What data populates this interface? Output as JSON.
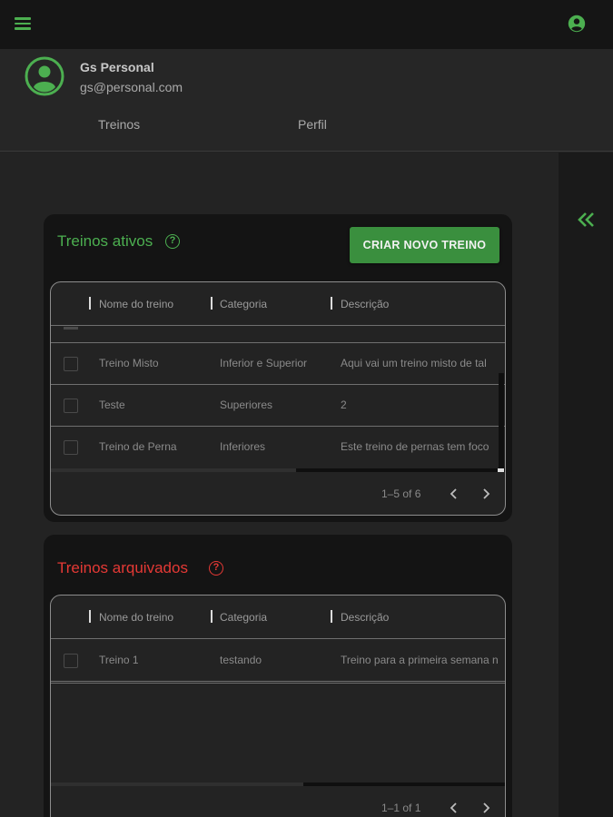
{
  "colors": {
    "accent_green": "#4caf50",
    "archived_red": "#e53935",
    "button_green": "#3a8f3e"
  },
  "icons": {
    "menu": "menu-icon",
    "account": "account-circle-icon",
    "avatar": "account-circle-icon",
    "collapse": "double-chevron-left-icon",
    "help": "help-circle-icon",
    "prev": "chevron-left-icon",
    "next": "chevron-right-icon"
  },
  "profile": {
    "name": "Gs Personal",
    "email": "gs@personal.com"
  },
  "nav": {
    "tabs": [
      {
        "label": "Treinos"
      },
      {
        "label": "Perfil"
      }
    ]
  },
  "active": {
    "title": "Treinos ativos",
    "help_glyph": "?",
    "create_button": "CRIAR NOVO TREINO",
    "columns": [
      "Nome do treino",
      "Categoria",
      "Descrição"
    ],
    "rows": [
      {
        "name": "Treino Misto",
        "category": "Inferior e Superior",
        "description": "Aqui vai um treino misto de tal"
      },
      {
        "name": "Teste",
        "category": "Superiores",
        "description": "2"
      },
      {
        "name": "Treino de Perna",
        "category": "Inferiores",
        "description": "Este treino de pernas tem foco"
      }
    ],
    "pagination": "1–5 of 6"
  },
  "archived": {
    "title": "Treinos arquivados",
    "help_glyph": "?",
    "columns": [
      "Nome do treino",
      "Categoria",
      "Descrição"
    ],
    "rows": [
      {
        "name": "Treino 1",
        "category": "testando",
        "description": "Treino para a primeira semana n"
      }
    ],
    "pagination": "1–1 of 1"
  }
}
